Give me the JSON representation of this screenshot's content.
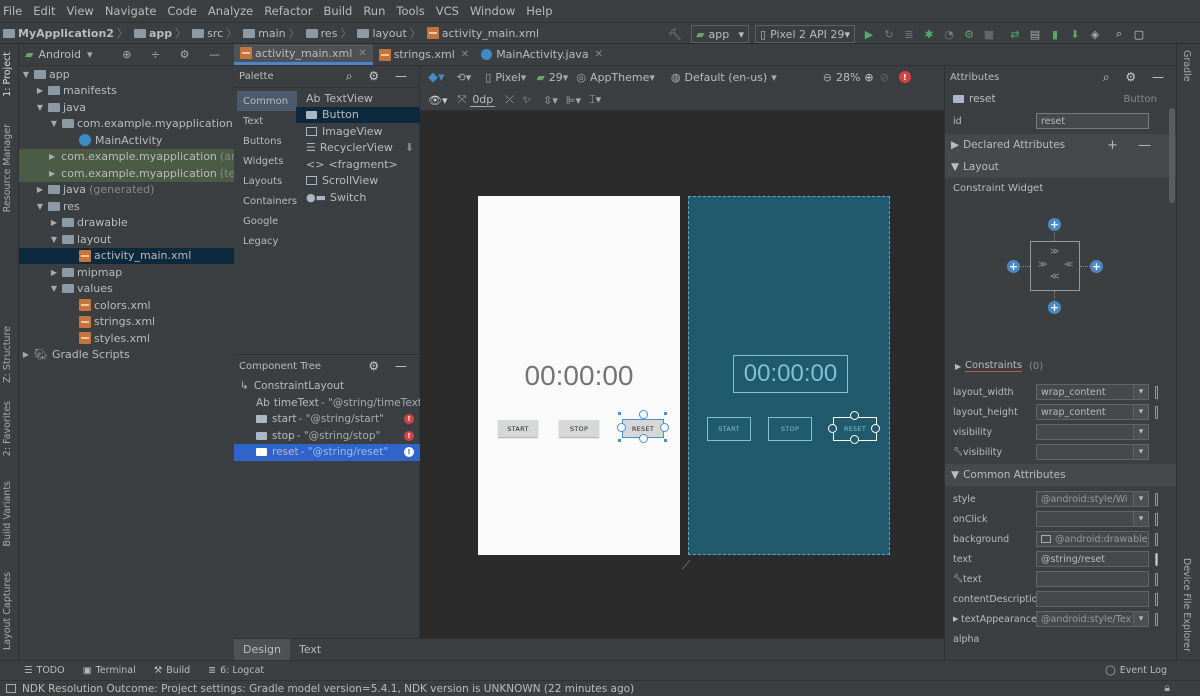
{
  "menu": [
    "File",
    "Edit",
    "View",
    "Navigate",
    "Code",
    "Analyze",
    "Refactor",
    "Build",
    "Run",
    "Tools",
    "VCS",
    "Window",
    "Help"
  ],
  "breadcrumbs": [
    "MyApplication2",
    "app",
    "src",
    "main",
    "res",
    "layout",
    "activity_main.xml"
  ],
  "run_config": "app",
  "device": "Pixel 2 API 29",
  "left_tabs": {
    "project": "1: Project",
    "resource_manager": "Resource Manager",
    "structure": "Z: Structure",
    "favorites": "2: Favorites",
    "build_variants": "Build Variants",
    "layout_captures": "Layout Captures"
  },
  "right_tabs": {
    "gradle": "Gradle",
    "device_explorer": "Device File Explorer"
  },
  "project": {
    "view_mode": "Android",
    "tree": [
      {
        "label": "app",
        "suffix": ""
      },
      {
        "label": "manifests",
        "suffix": ""
      },
      {
        "label": "java",
        "suffix": ""
      },
      {
        "label": "com.example.myapplication",
        "suffix": ""
      },
      {
        "label": "MainActivity",
        "suffix": ""
      },
      {
        "label": "com.example.myapplication",
        "suffix": "(andro"
      },
      {
        "label": "com.example.myapplication",
        "suffix": "(test)"
      },
      {
        "label": "java",
        "suffix": "(generated)"
      },
      {
        "label": "res",
        "suffix": ""
      },
      {
        "label": "drawable",
        "suffix": ""
      },
      {
        "label": "layout",
        "suffix": ""
      },
      {
        "label": "activity_main.xml",
        "suffix": ""
      },
      {
        "label": "mipmap",
        "suffix": ""
      },
      {
        "label": "values",
        "suffix": ""
      },
      {
        "label": "colors.xml",
        "suffix": ""
      },
      {
        "label": "strings.xml",
        "suffix": ""
      },
      {
        "label": "styles.xml",
        "suffix": ""
      },
      {
        "label": "Gradle Scripts",
        "suffix": ""
      }
    ]
  },
  "editor_tabs": [
    "activity_main.xml",
    "strings.xml",
    "MainActivity.java"
  ],
  "palette": {
    "title": "Palette",
    "categories": [
      "Common",
      "Text",
      "Buttons",
      "Widgets",
      "Layouts",
      "Containers",
      "Google",
      "Legacy"
    ],
    "items": [
      "TextView",
      "Button",
      "ImageView",
      "RecyclerView",
      "<fragment>",
      "ScrollView",
      "Switch"
    ],
    "item_prefixes": [
      "Ab",
      "",
      "",
      "",
      "<>",
      "",
      ""
    ]
  },
  "component_tree": {
    "title": "Component Tree",
    "root": "ConstraintLayout",
    "items": [
      {
        "prefix": "Ab",
        "name": "timeText",
        "value": "- \"@string/timeText\""
      },
      {
        "prefix": "",
        "name": "start",
        "value": "- \"@string/start\""
      },
      {
        "prefix": "",
        "name": "stop",
        "value": "- \"@string/stop\""
      },
      {
        "prefix": "",
        "name": "reset",
        "value": "- \"@string/reset\""
      }
    ]
  },
  "design_toolbar": {
    "device": "Pixel",
    "api": "29",
    "theme": "AppTheme",
    "locale": "Default (en-us)",
    "zoom": "28%",
    "margin": "0dp"
  },
  "preview": {
    "time": "00:00:00",
    "start": "START",
    "stop": "STOP",
    "reset": "RESET"
  },
  "design_tabs": [
    "Design",
    "Text"
  ],
  "attributes": {
    "title": "Attributes",
    "component_name": "reset",
    "component_type": "Button",
    "id_label": "id",
    "id_value": "reset",
    "declared": "Declared Attributes",
    "layout": "Layout",
    "constraint_widget": "Constraint Widget",
    "constraints": "Constraints",
    "constraints_count": "(0)",
    "rows": [
      {
        "label": "layout_width",
        "value": "wrap_content"
      },
      {
        "label": "layout_height",
        "value": "wrap_content"
      },
      {
        "label": "visibility",
        "value": ""
      },
      {
        "label": "visibility",
        "value": ""
      }
    ],
    "common": "Common Attributes",
    "common_rows": [
      {
        "label": "style",
        "value": "@android:style/Wi"
      },
      {
        "label": "onClick",
        "value": ""
      },
      {
        "label": "background",
        "value": "@android:drawable/b"
      },
      {
        "label": "text",
        "value": "@string/reset"
      },
      {
        "label": "text",
        "value": ""
      },
      {
        "label": "contentDescription",
        "value": ""
      },
      {
        "label": "textAppearance",
        "value": "@android:style/Tex"
      },
      {
        "label": "alpha",
        "value": ""
      }
    ]
  },
  "bottom_tools": [
    "TODO",
    "Terminal",
    "Build",
    "6: Logcat"
  ],
  "event_log": "Event Log",
  "status": "NDK Resolution Outcome: Project settings: Gradle model version=5.4.1, NDK version is UNKNOWN (22 minutes ago)"
}
